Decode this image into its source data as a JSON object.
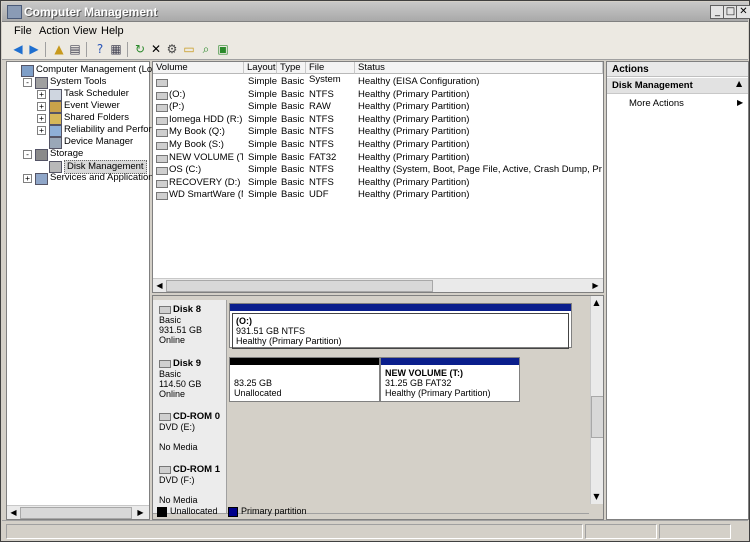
{
  "window": {
    "title": "Computer Management"
  },
  "menu": [
    "File",
    "Action",
    "View",
    "Help"
  ],
  "tree": [
    {
      "label": "Computer Management (Local)",
      "depth": 0,
      "expander": "",
      "icon": "computer-icon"
    },
    {
      "label": "System Tools",
      "depth": 1,
      "expander": "−",
      "icon": "tools-icon"
    },
    {
      "label": "Task Scheduler",
      "depth": 2,
      "expander": "+",
      "icon": "clock-icon"
    },
    {
      "label": "Event Viewer",
      "depth": 2,
      "expander": "+",
      "icon": "event-icon"
    },
    {
      "label": "Shared Folders",
      "depth": 2,
      "expander": "+",
      "icon": "folder-icon"
    },
    {
      "label": "Reliability and Performanc",
      "depth": 2,
      "expander": "+",
      "icon": "performance-icon"
    },
    {
      "label": "Device Manager",
      "depth": 2,
      "expander": "",
      "icon": "device-icon"
    },
    {
      "label": "Storage",
      "depth": 1,
      "expander": "−",
      "icon": "storage-icon"
    },
    {
      "label": "Disk Management",
      "depth": 2,
      "expander": "",
      "icon": "disk-icon",
      "selected": true
    },
    {
      "label": "Services and Applications",
      "depth": 1,
      "expander": "+",
      "icon": "services-icon"
    }
  ],
  "volumes": {
    "columns": [
      "Volume",
      "Layout",
      "Type",
      "File System",
      "Status"
    ],
    "rows": [
      [
        "",
        "Simple",
        "Basic",
        "",
        "Healthy (EISA Configuration)"
      ],
      [
        "(O:)",
        "Simple",
        "Basic",
        "NTFS",
        "Healthy (Primary Partition)"
      ],
      [
        "(P:)",
        "Simple",
        "Basic",
        "RAW",
        "Healthy (Primary Partition)"
      ],
      [
        "Iomega HDD (R:)",
        "Simple",
        "Basic",
        "NTFS",
        "Healthy (Primary Partition)"
      ],
      [
        "My Book (Q:)",
        "Simple",
        "Basic",
        "NTFS",
        "Healthy (Primary Partition)"
      ],
      [
        "My Book (S:)",
        "Simple",
        "Basic",
        "NTFS",
        "Healthy (Primary Partition)"
      ],
      [
        "NEW VOLUME (T:)",
        "Simple",
        "Basic",
        "FAT32",
        "Healthy (Primary Partition)"
      ],
      [
        "OS (C:)",
        "Simple",
        "Basic",
        "NTFS",
        "Healthy (System, Boot, Page File, Active, Crash Dump, Primary Parti"
      ],
      [
        "RECOVERY (D:)",
        "Simple",
        "Basic",
        "NTFS",
        "Healthy (Primary Partition)"
      ],
      [
        "WD SmartWare (M:)",
        "Simple",
        "Basic",
        "UDF",
        "Healthy (Primary Partition)"
      ]
    ]
  },
  "disks": [
    {
      "name": "Disk 8",
      "lines": [
        "Basic",
        "931.51 GB",
        "Online"
      ],
      "partitions": [
        {
          "title": "(O:)",
          "size": "931.51 GB NTFS",
          "status": "Healthy (Primary Partition)",
          "kind": "primary"
        }
      ]
    },
    {
      "name": "Disk 9",
      "lines": [
        "Basic",
        "114.50 GB",
        "Online"
      ],
      "partitions": [
        {
          "title": "",
          "size": "83.25 GB",
          "status": "Unallocated",
          "kind": "unallocated"
        },
        {
          "title": "NEW VOLUME  (T:)",
          "size": "31.25 GB FAT32",
          "status": "Healthy (Primary Partition)",
          "kind": "primary"
        }
      ]
    },
    {
      "name": "CD-ROM 0",
      "lines": [
        "DVD (E:)",
        "",
        "No Media"
      ],
      "partitions": []
    },
    {
      "name": "CD-ROM 1",
      "lines": [
        "DVD (F:)",
        "",
        "No Media"
      ],
      "partitions": []
    }
  ],
  "legend": [
    {
      "label": "Unallocated",
      "color": "#000000"
    },
    {
      "label": "Primary partition",
      "color": "#00008b"
    }
  ],
  "actions": {
    "header": "Actions",
    "section": "Disk Management",
    "items": [
      "More Actions"
    ]
  },
  "colors": {
    "primary_partition": "#0a1e8c",
    "unallocated": "#000000"
  }
}
